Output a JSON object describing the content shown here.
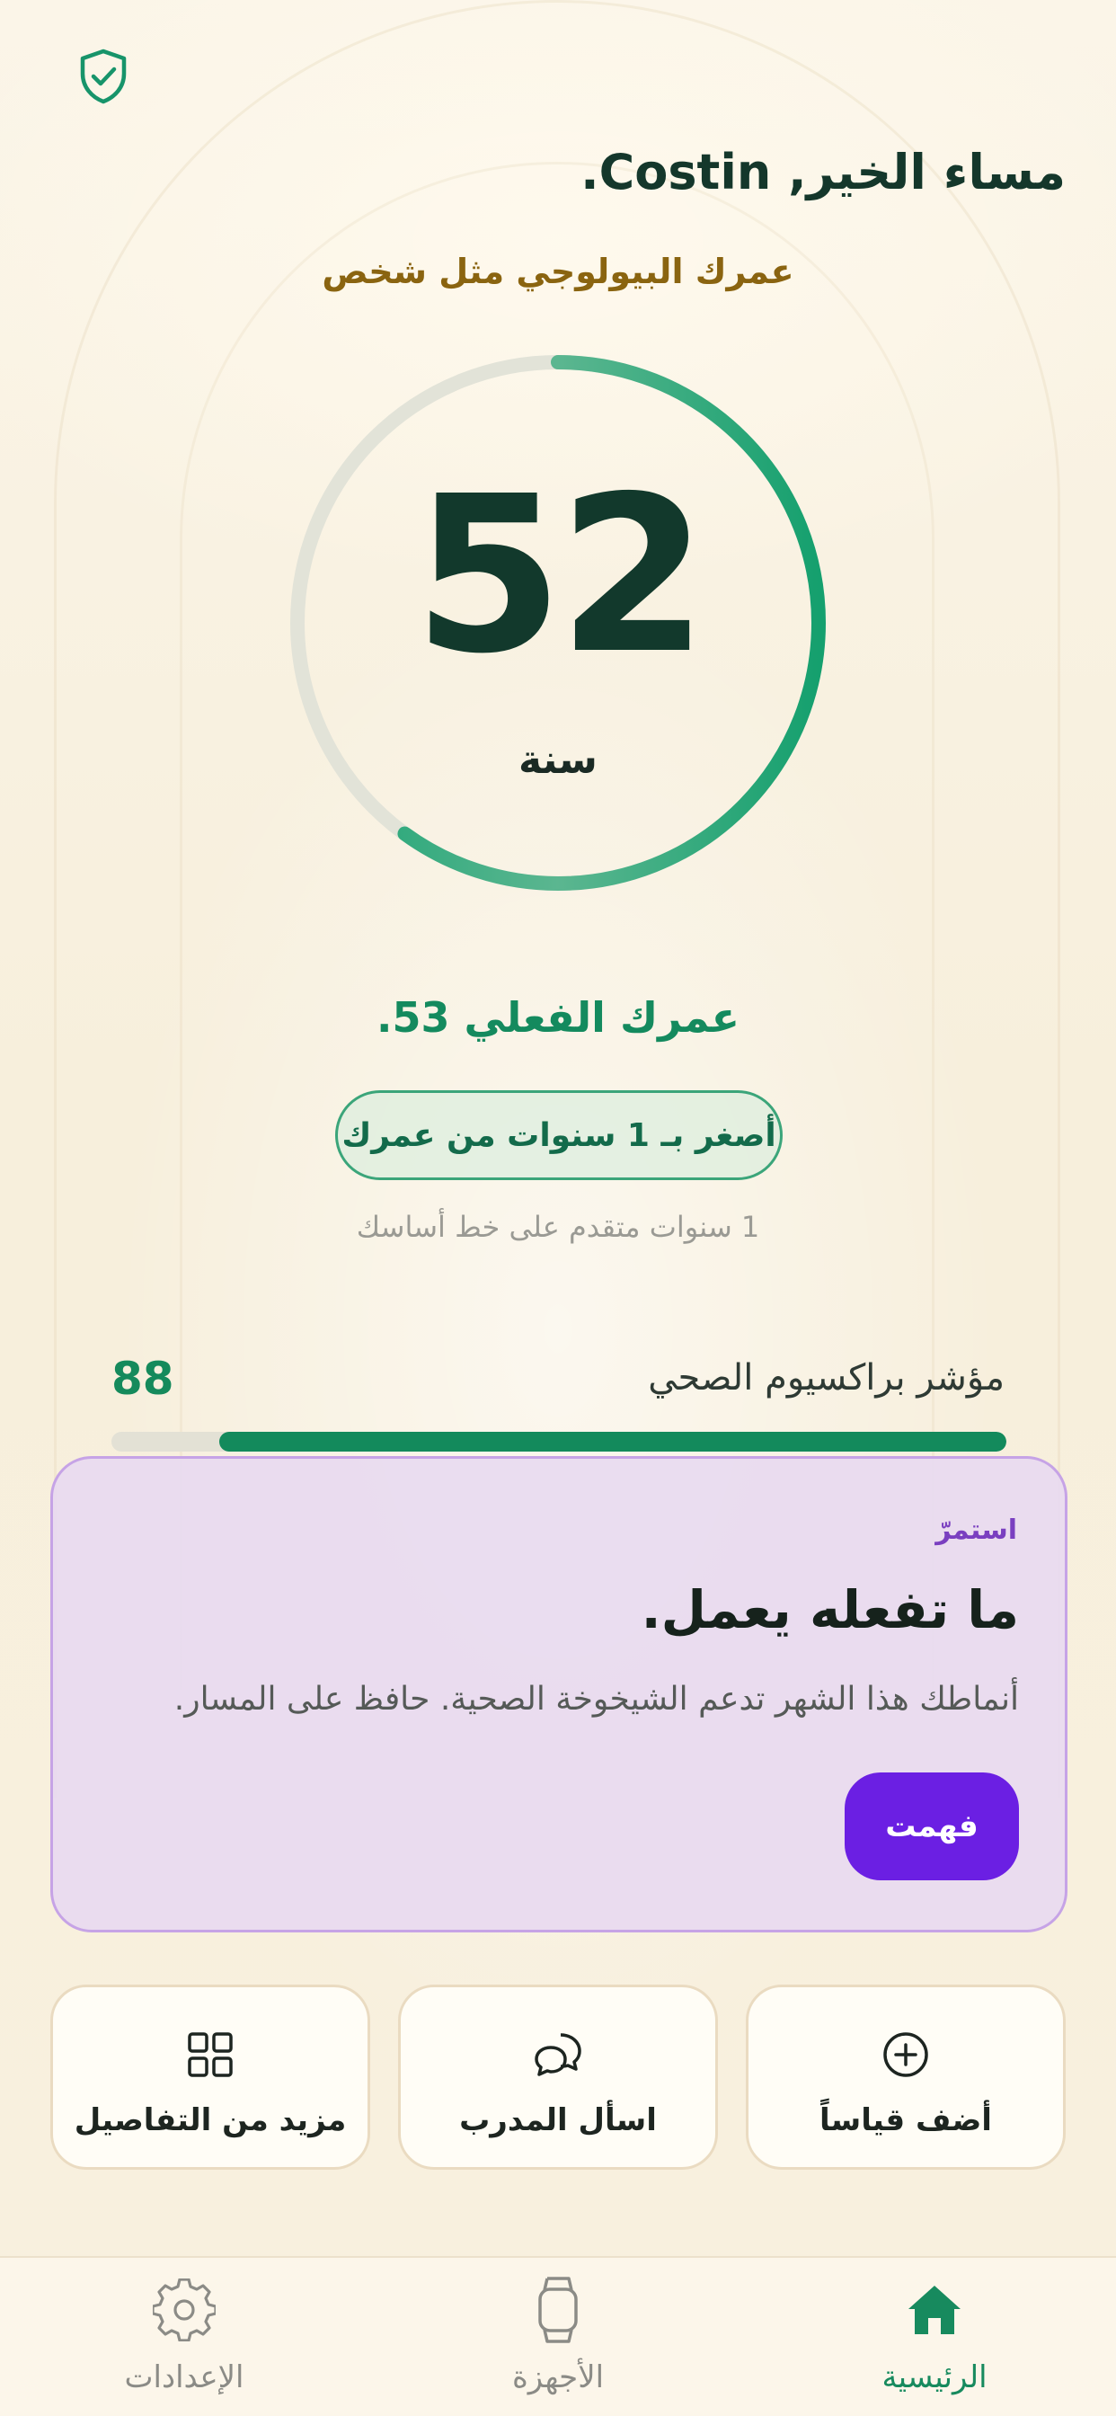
{
  "greeting": "مساء الخير, Costin.",
  "bio_age": {
    "label": "عمرك البيولوجي مثل شخص",
    "value": "52",
    "unit": "سنة",
    "ring_progress": 0.6
  },
  "actual_age_text": "عمرك الفعلي 53.",
  "younger_pill": "أصغر بـ 1 سنوات من عمرك",
  "baseline_text": "1 سنوات متقدم على خط أساسك",
  "health_index": {
    "label": "مؤشر براكسيوم الصحي",
    "value": "88",
    "progress": 0.88
  },
  "card": {
    "kicker": "استمرّ",
    "title": "ما تفعله يعمل.",
    "body": "أنماطك هذا الشهر تدعم الشيخوخة الصحية. حافظ على المسار.",
    "button": "فهمت"
  },
  "tiles": [
    {
      "label": "أضف قياساً",
      "icon": "plus-circle-icon"
    },
    {
      "label": "اسأل المدرب",
      "icon": "chat-bubbles-icon"
    },
    {
      "label": "مزيد من التفاصيل",
      "icon": "grid-icon"
    }
  ],
  "nav": [
    {
      "label": "الرئيسية",
      "icon": "home-icon",
      "active": true
    },
    {
      "label": "الأجهزة",
      "icon": "watch-icon",
      "active": false
    },
    {
      "label": "الإعدادات",
      "icon": "gear-icon",
      "active": false
    }
  ],
  "colors": {
    "accent": "#148a5e",
    "card_button": "#6b1fe3",
    "background": "#f9f2e2"
  }
}
